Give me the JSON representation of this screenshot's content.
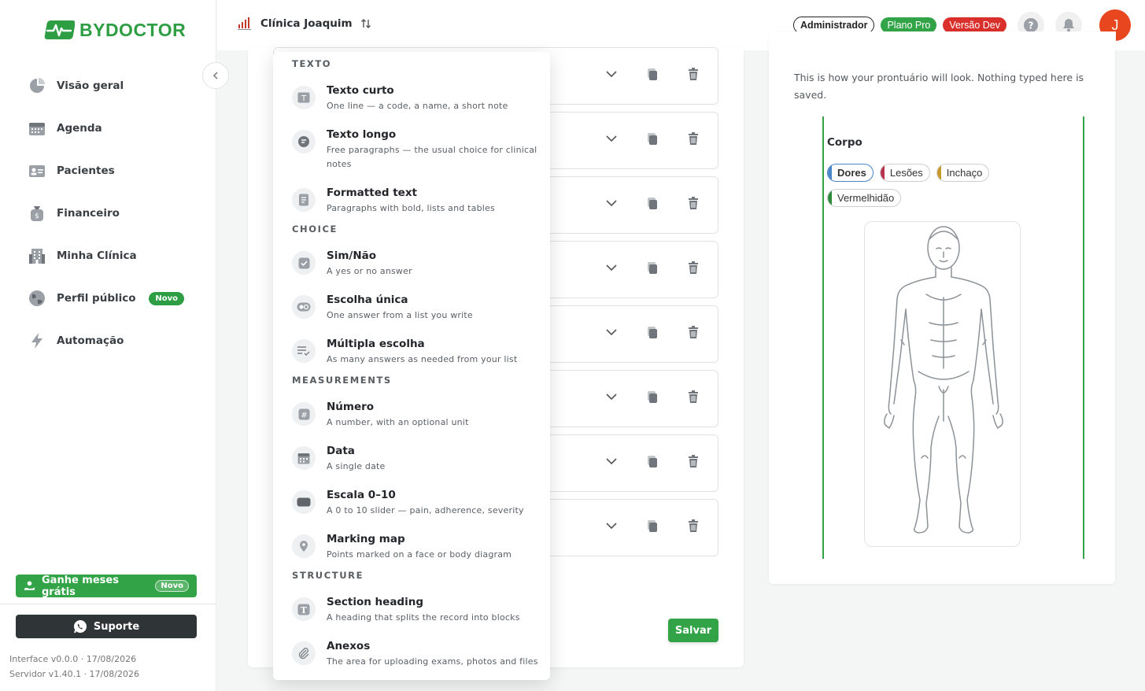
{
  "brand": {
    "name": "BYDOCTOR",
    "color": "#2e9e44"
  },
  "sidebar": {
    "items": [
      {
        "label": "Visão geral",
        "icon": "pie-chart-icon"
      },
      {
        "label": "Agenda",
        "icon": "calendar-icon"
      },
      {
        "label": "Pacientes",
        "icon": "id-card-icon"
      },
      {
        "label": "Financeiro",
        "icon": "money-bag-icon"
      },
      {
        "label": "Minha Clínica",
        "icon": "building-icon"
      },
      {
        "label": "Perfil público",
        "icon": "globe-icon",
        "badge": "Novo"
      },
      {
        "label": "Automação",
        "icon": "lightning-icon"
      }
    ],
    "promo": {
      "label": "Ganhe meses grátis",
      "badge": "Novo"
    },
    "support": {
      "label": "Suporte"
    },
    "versions": {
      "interface": "Interface v0.0.0 · 17/08/2026",
      "server": "Servidor v1.40.1 · 17/08/2026"
    }
  },
  "topbar": {
    "clinic": "Clínica Joaquim",
    "role": "Administrador",
    "plan": "Plano Pro",
    "version": "Versão Dev",
    "avatar_initial": "J"
  },
  "form": {
    "save_label": "Salvar"
  },
  "dropdown": {
    "sections": [
      {
        "title": "TEXTO",
        "items": [
          {
            "title": "Texto curto",
            "desc": "One line — a code, a name, a short note",
            "icon": "text-t-icon"
          },
          {
            "title": "Texto longo",
            "desc": "Free paragraphs — the usual choice for clinical notes",
            "icon": "paragraph-icon"
          },
          {
            "title": "Formatted text",
            "desc": "Paragraphs with bold, lists and tables",
            "icon": "document-icon"
          }
        ]
      },
      {
        "title": "CHOICE",
        "items": [
          {
            "title": "Sim/Não",
            "desc": "A yes or no answer",
            "icon": "checkbox-icon"
          },
          {
            "title": "Escolha única",
            "desc": "One answer from a list you write",
            "icon": "radio-icon"
          },
          {
            "title": "Múltipla escolha",
            "desc": "As many answers as needed from your list",
            "icon": "checklist-icon"
          }
        ]
      },
      {
        "title": "MEASUREMENTS",
        "items": [
          {
            "title": "Número",
            "desc": "A number, with an optional unit",
            "icon": "hash-icon"
          },
          {
            "title": "Data",
            "desc": "A single date",
            "icon": "calendar-icon"
          },
          {
            "title": "Escala 0–10",
            "desc": "A 0 to 10 slider — pain, adherence, severity",
            "icon": "slider-icon"
          },
          {
            "title": "Marking map",
            "desc": "Points marked on a face or body diagram",
            "icon": "pin-icon"
          }
        ]
      },
      {
        "title": "STRUCTURE",
        "items": [
          {
            "title": "Section heading",
            "desc": "A heading that splits the record into blocks",
            "icon": "heading-icon"
          },
          {
            "title": "Anexos",
            "desc": "The area for uploading exams, photos and files",
            "icon": "paperclip-icon"
          }
        ]
      }
    ]
  },
  "preview": {
    "description": "This is how your prontuário will look. Nothing typed here is saved.",
    "block_title": "Corpo",
    "chips": [
      {
        "label": "Dores",
        "color": "#4a86c8",
        "selected": true
      },
      {
        "label": "Lesões",
        "color": "#b8344e",
        "selected": false
      },
      {
        "label": "Inchaço",
        "color": "#c59a2a",
        "selected": false
      },
      {
        "label": "Vermelhidão",
        "color": "#2e8a3c",
        "selected": false
      }
    ]
  }
}
